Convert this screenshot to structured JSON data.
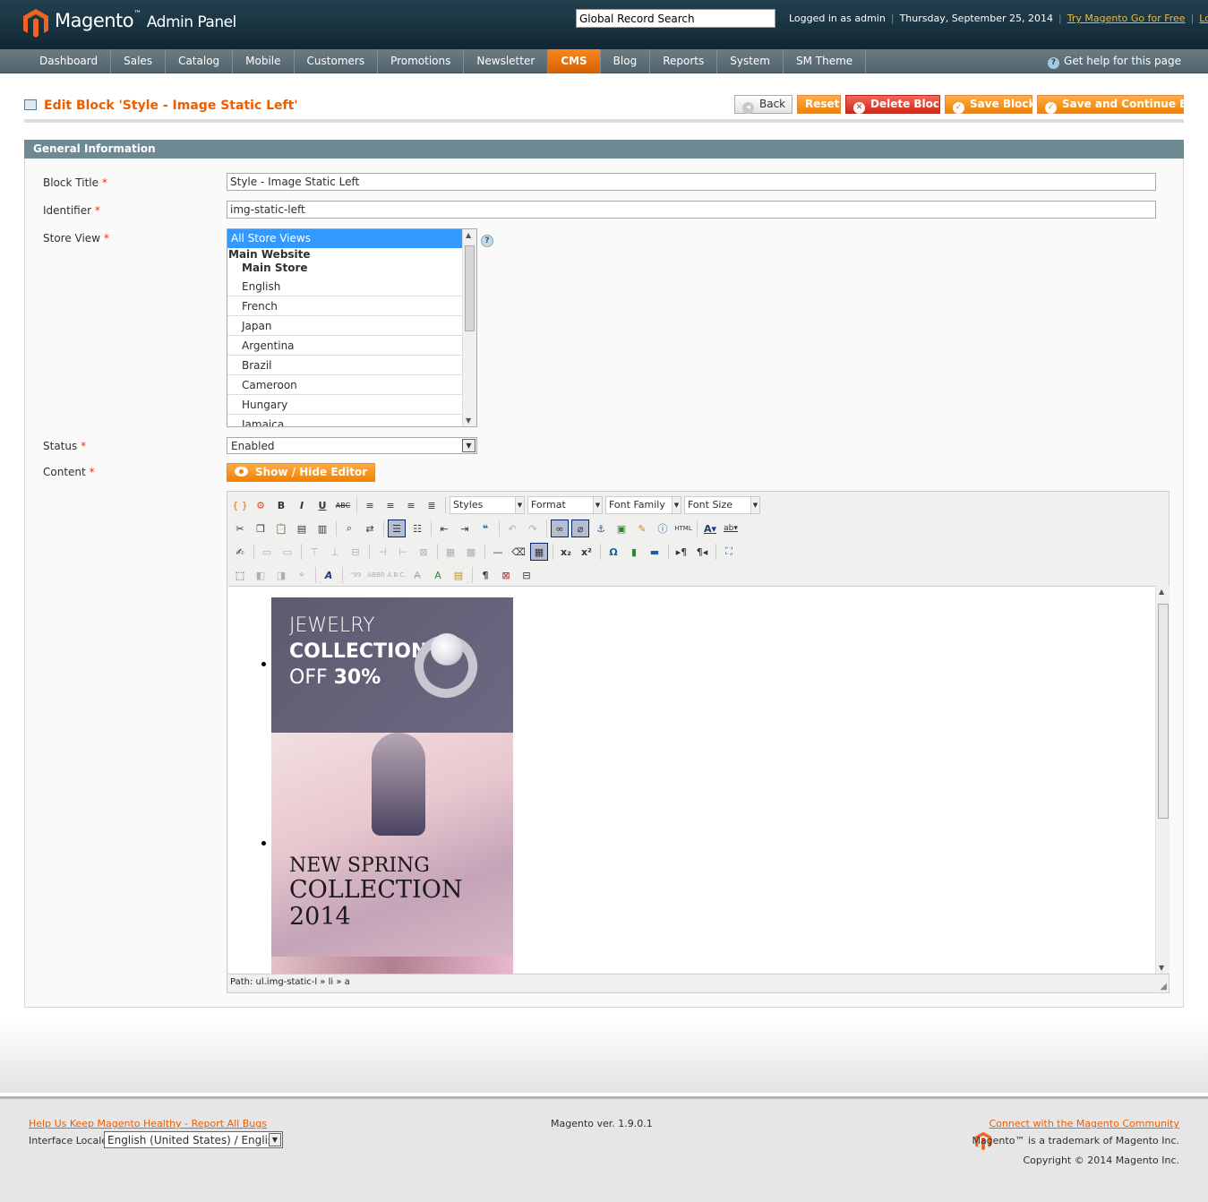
{
  "header": {
    "logo_text": "Magento",
    "logo_tm": "™",
    "logo_sub": "Admin Panel",
    "search_placeholder": "Global Record Search",
    "logged_in": "Logged in as admin",
    "date": "Thursday, September 25, 2014",
    "try_link": "Try Magento Go for Free",
    "logout": "Log Out"
  },
  "nav": {
    "items": [
      "Dashboard",
      "Sales",
      "Catalog",
      "Mobile",
      "Customers",
      "Promotions",
      "Newsletter",
      "CMS",
      "Blog",
      "Reports",
      "System",
      "SM Theme"
    ],
    "active": "CMS",
    "help": "Get help for this page"
  },
  "page": {
    "title": "Edit Block 'Style - Image Static Left'",
    "buttons": {
      "back": "Back",
      "reset": "Reset",
      "delete": "Delete Block",
      "save": "Save Block",
      "save_continue": "Save and Continue Edit"
    }
  },
  "form": {
    "section": "General Information",
    "block_title_label": "Block Title",
    "block_title_value": "Style - Image Static Left",
    "identifier_label": "Identifier",
    "identifier_value": "img-static-left",
    "store_view_label": "Store View",
    "store_views": {
      "selected": "All Store Views",
      "website": "Main Website",
      "store": "Main Store",
      "views": [
        "English",
        "French",
        "Japan",
        "Argentina",
        "Brazil",
        "Cameroon",
        "Hungary",
        "Jamaica"
      ]
    },
    "status_label": "Status",
    "status_value": "Enabled",
    "content_label": "Content",
    "show_hide": "Show / Hide Editor",
    "required_mark": "*"
  },
  "editor": {
    "selects": [
      "Styles",
      "Format",
      "Font Family",
      "Font Size"
    ],
    "path": "Path: ul.img-static-l » li » a",
    "banner1": {
      "line1": "JEWELRY",
      "line2": "COLLECTION",
      "line3a": "OFF ",
      "line3b": "30%"
    },
    "banner2": {
      "line1": "NEW SPRING",
      "line2": "COLLECTION",
      "line3": "2014"
    }
  },
  "footer": {
    "bugs_link": "Help Us Keep Magento Healthy - Report All Bugs",
    "locale_label": "Interface Locale:",
    "locale_value": "English (United States) / English",
    "version": "Magento ver. 1.9.0.1",
    "connect_link": "Connect with the Magento Community",
    "trademark": "Magento™ is a trademark of Magento Inc.",
    "copyright": "Copyright © 2014 Magento Inc."
  },
  "colors": {
    "accent": "#eb5e00",
    "header_bg": "#1a3542",
    "nav_bg": "#5e6f77",
    "section_bg": "#6f8992"
  }
}
